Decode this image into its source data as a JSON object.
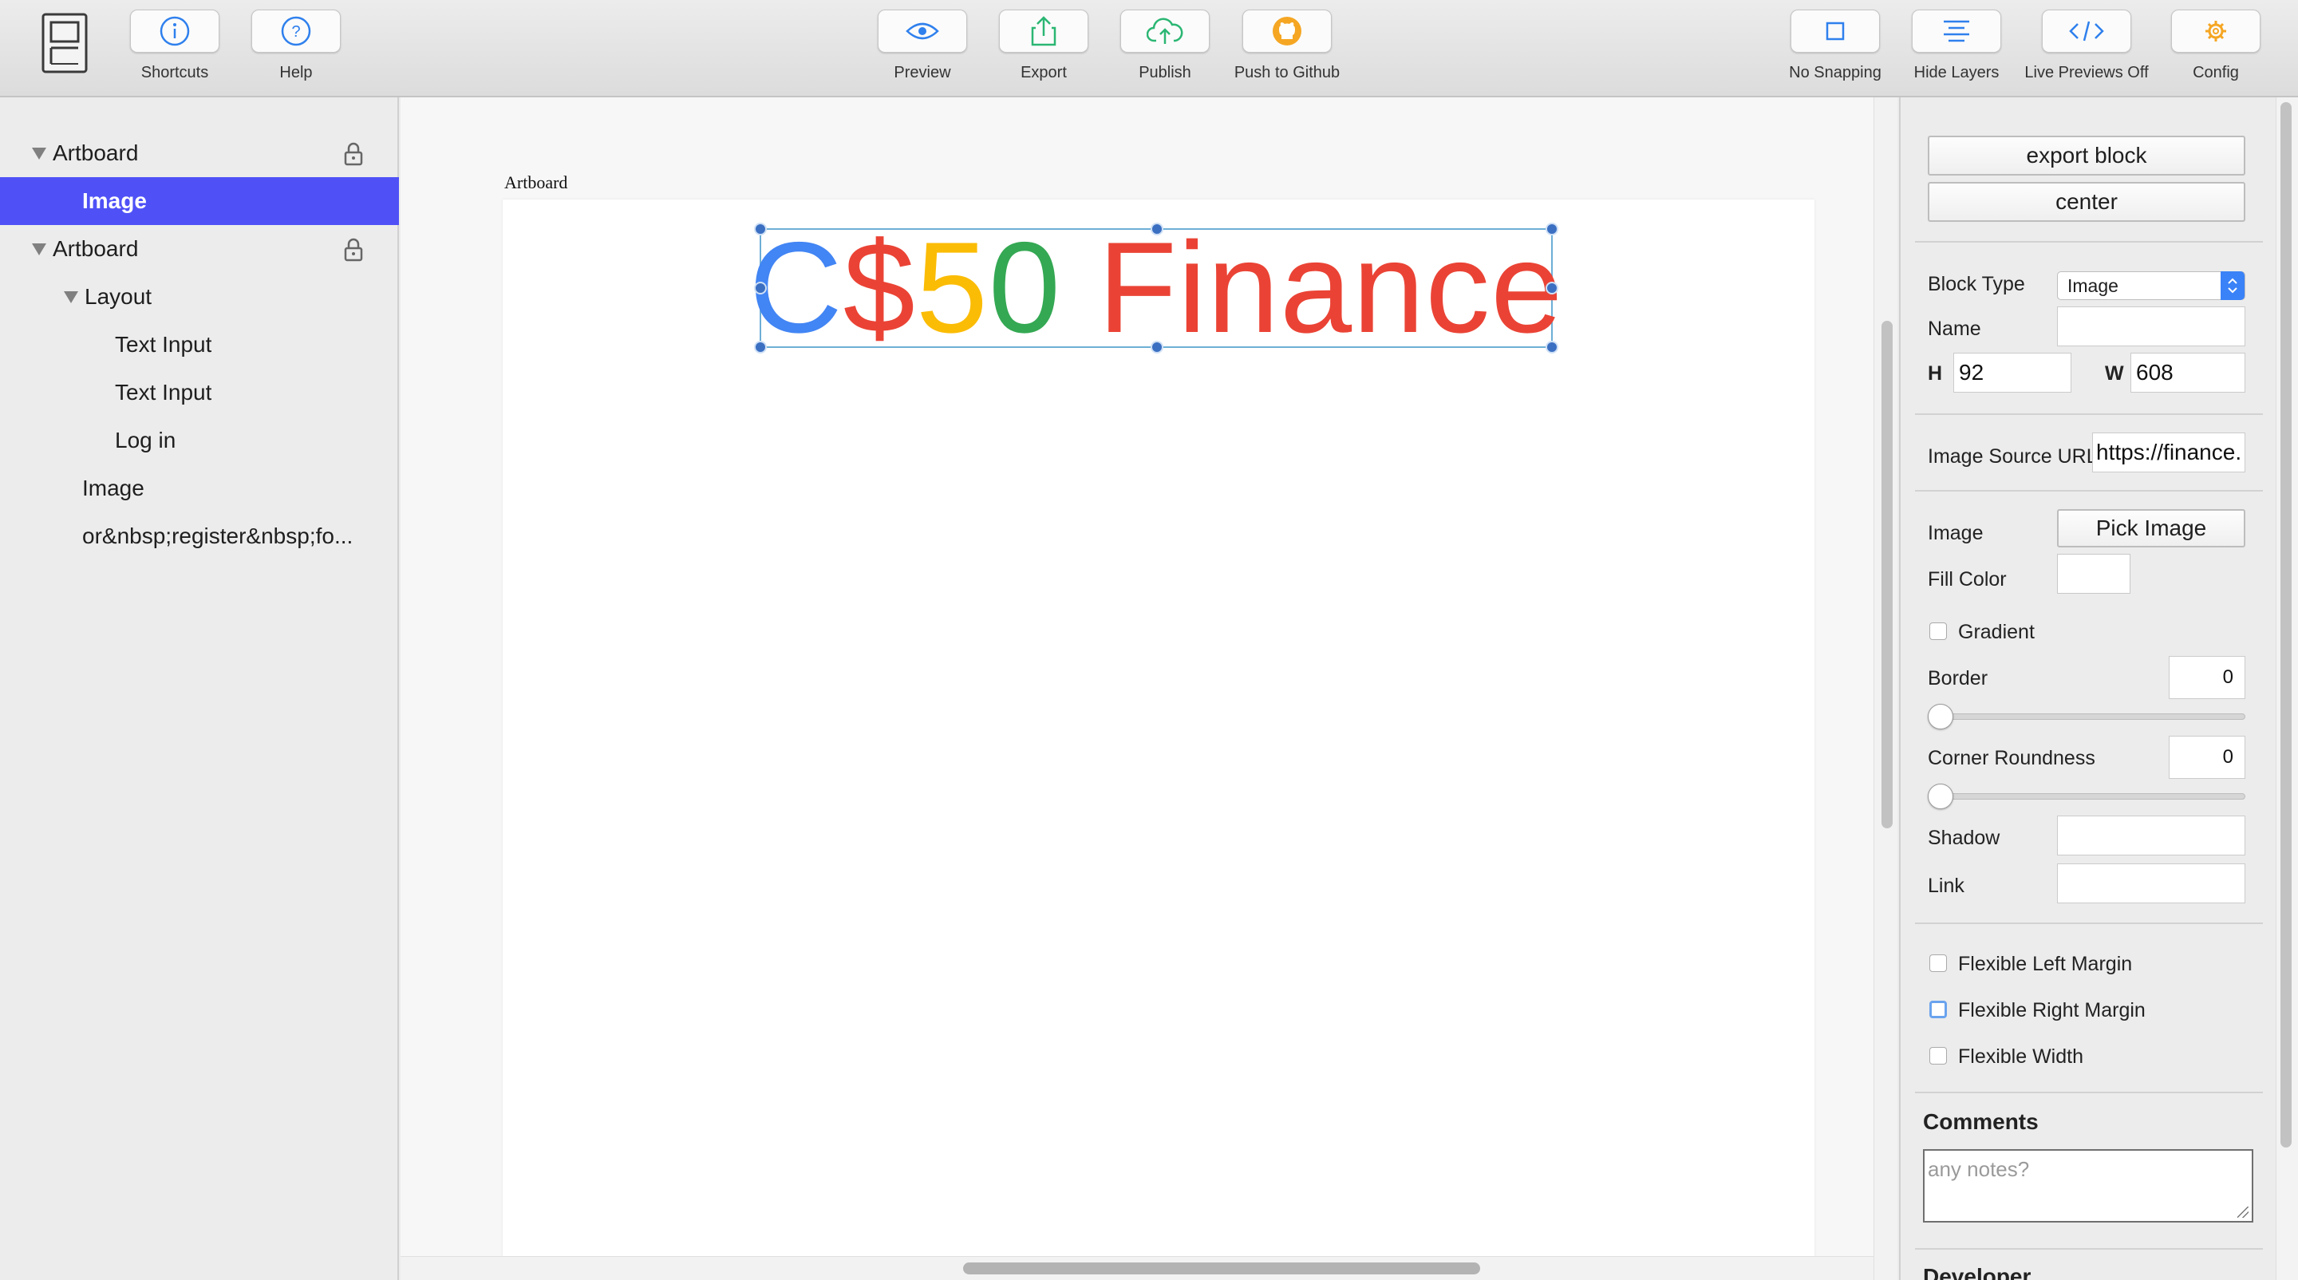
{
  "toolbar": {
    "left_buttons": [
      {
        "label": "Shortcuts",
        "icon": "info-icon"
      },
      {
        "label": "Help",
        "icon": "question-icon"
      }
    ],
    "center_buttons": [
      {
        "label": "Preview",
        "icon": "eye-icon"
      },
      {
        "label": "Export",
        "icon": "share-upload-icon"
      },
      {
        "label": "Publish",
        "icon": "cloud-upload-icon"
      },
      {
        "label": "Push to Github",
        "icon": "github-icon"
      }
    ],
    "right_buttons": [
      {
        "label": "No Snapping",
        "icon": "square-icon"
      },
      {
        "label": "Hide Layers",
        "icon": "align-lines-icon"
      },
      {
        "label": "Live Previews Off",
        "icon": "code-icon"
      },
      {
        "label": "Config",
        "icon": "gear-icon"
      }
    ],
    "icon_colors": {
      "blue": "#2f80ed",
      "green": "#2bb673",
      "orange": "#f5a623"
    }
  },
  "layers": [
    {
      "label": "Artboard",
      "expanded": true,
      "locked": true
    },
    {
      "label": "Image",
      "selected": true
    },
    {
      "label": "Artboard",
      "expanded": true,
      "locked": true
    },
    {
      "label": "Layout",
      "expanded": true
    },
    {
      "label": "Text Input"
    },
    {
      "label": "Text Input"
    },
    {
      "label": "Log in"
    },
    {
      "label": "Image"
    },
    {
      "label": "or&nbsp;register&nbsp;fo..."
    }
  ],
  "canvas": {
    "artboard_label": "Artboard",
    "logo": {
      "parts": [
        {
          "text": "C",
          "color": "#4285f4"
        },
        {
          "text": "$",
          "color": "#ea4335"
        },
        {
          "text": "5",
          "color": "#fbbc05"
        },
        {
          "text": "0",
          "color": "#34a853"
        },
        {
          "text": " Finance",
          "color": "#ea4335"
        }
      ]
    }
  },
  "inspector": {
    "export_block_label": "export block",
    "center_label": "center",
    "block_type_label": "Block Type",
    "block_type_value": "Image",
    "name_label": "Name",
    "name_value": "",
    "h_label": "H",
    "h_value": "92",
    "w_label": "W",
    "w_value": "608",
    "image_source_label": "Image Source URL",
    "image_source_value": "https://finance.",
    "image_label": "Image",
    "pick_image_label": "Pick Image",
    "fill_color_label": "Fill Color",
    "gradient_label": "Gradient",
    "border_label": "Border",
    "border_value": "0",
    "corner_roundness_label": "Corner Roundness",
    "corner_roundness_value": "0",
    "shadow_label": "Shadow",
    "shadow_value": "",
    "link_label": "Link",
    "link_value": "",
    "flex_left_label": "Flexible Left Margin",
    "flex_right_label": "Flexible Right Margin",
    "flex_width_label": "Flexible Width",
    "comments_label": "Comments",
    "comments_placeholder": "any notes?",
    "developer_label": "Developer",
    "selection_color": "#4f51f6"
  }
}
